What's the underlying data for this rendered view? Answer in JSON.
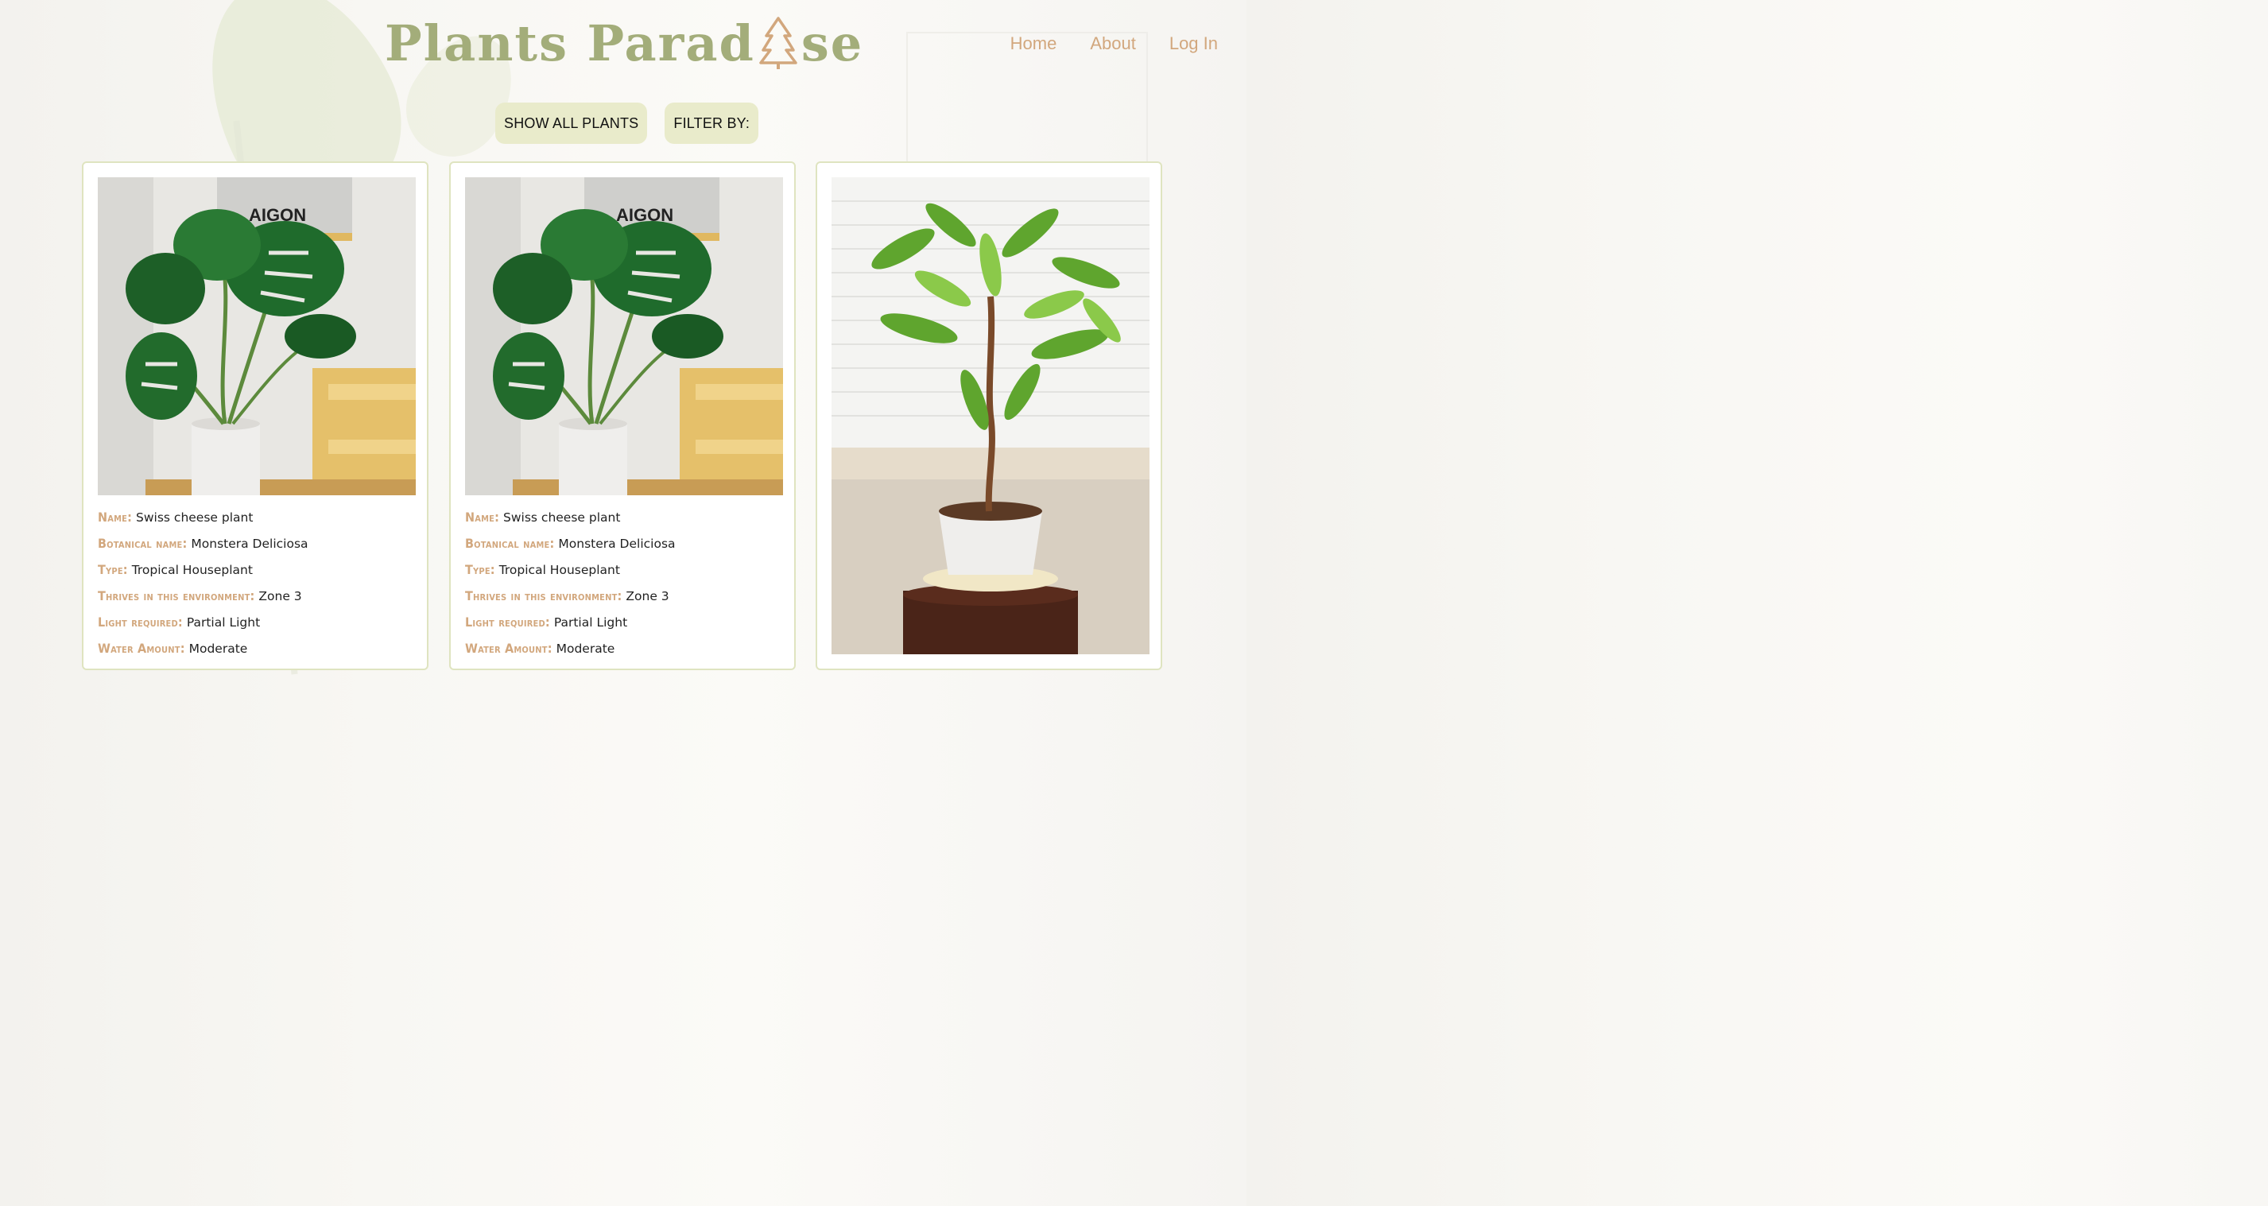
{
  "header": {
    "logo_text_left": "Plants Parad",
    "logo_text_right": "se",
    "logo_icon": "pine-tree-icon",
    "brand_color": "#a3ad7a",
    "accent_color": "#d2a77d"
  },
  "nav": {
    "items": [
      {
        "label": "Home"
      },
      {
        "label": "About"
      },
      {
        "label": "Log In"
      }
    ]
  },
  "controls": {
    "show_all_label": "SHOW ALL PLANTS",
    "filter_label": "FILTER BY:"
  },
  "cards": [
    {
      "photo": "monstera-photo",
      "fields": [
        {
          "label": "Name:",
          "value": "Swiss cheese plant"
        },
        {
          "label": "Botanical name:",
          "value": "Monstera Deliciosa"
        },
        {
          "label": "Type:",
          "value": "Tropical Houseplant"
        },
        {
          "label": "Thrives in this environment:",
          "value": "Zone 3"
        },
        {
          "label": "Light required:",
          "value": "Partial Light"
        },
        {
          "label": "Water Amount:",
          "value": "Moderate"
        }
      ]
    },
    {
      "photo": "monstera-photo",
      "fields": [
        {
          "label": "Name:",
          "value": "Swiss cheese plant"
        },
        {
          "label": "Botanical name:",
          "value": "Monstera Deliciosa"
        },
        {
          "label": "Type:",
          "value": "Tropical Houseplant"
        },
        {
          "label": "Thrives in this environment:",
          "value": "Zone 3"
        },
        {
          "label": "Light required:",
          "value": "Partial Light"
        },
        {
          "label": "Water Amount:",
          "value": "Moderate"
        }
      ]
    },
    {
      "photo": "money-tree-photo",
      "fields": []
    }
  ]
}
